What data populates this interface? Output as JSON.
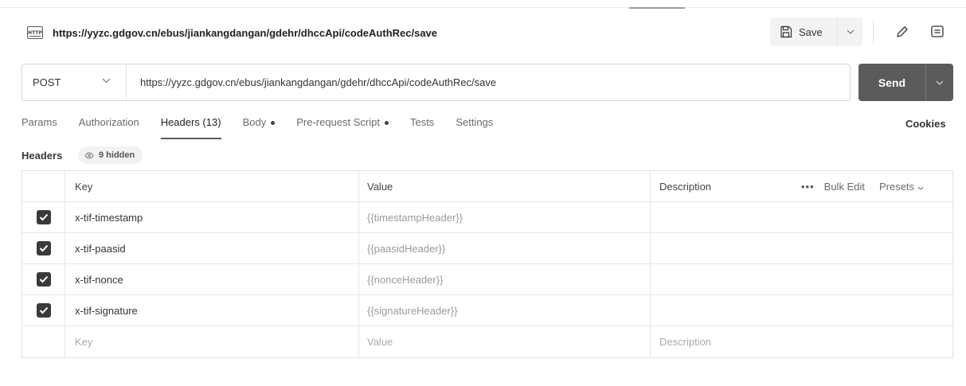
{
  "request": {
    "title": "https://yyzc.gdgov.cn/ebus/jiankangdangan/gdehr/dhccApi/codeAuthRec/save",
    "method": "POST",
    "url": "https://yyzc.gdgov.cn/ebus/jiankangdangan/gdehr/dhccApi/codeAuthRec/save"
  },
  "toolbar": {
    "save_label": "Save",
    "send_label": "Send"
  },
  "tabs": [
    {
      "label": "Params",
      "active": false,
      "dot": false
    },
    {
      "label": "Authorization",
      "active": false,
      "dot": false
    },
    {
      "label": "Headers (13)",
      "active": true,
      "dot": false
    },
    {
      "label": "Body",
      "active": false,
      "dot": true
    },
    {
      "label": "Pre-request Script",
      "active": false,
      "dot": true
    },
    {
      "label": "Tests",
      "active": false,
      "dot": false
    },
    {
      "label": "Settings",
      "active": false,
      "dot": false
    }
  ],
  "cookies_label": "Cookies",
  "headers_section": {
    "label": "Headers",
    "hidden_badge": "9 hidden"
  },
  "table": {
    "columns": {
      "key": "Key",
      "value": "Value",
      "description": "Description"
    },
    "actions": {
      "more": "•••",
      "bulk_edit": "Bulk Edit",
      "presets": "Presets"
    },
    "rows": [
      {
        "checked": true,
        "key": "x-tif-timestamp",
        "value": "{{timestampHeader}}",
        "description": ""
      },
      {
        "checked": true,
        "key": "x-tif-paasid",
        "value": "{{paasidHeader}}",
        "description": ""
      },
      {
        "checked": true,
        "key": "x-tif-nonce",
        "value": "{{nonceHeader}}",
        "description": ""
      },
      {
        "checked": true,
        "key": "x-tif-signature",
        "value": "{{signatureHeader}}",
        "description": ""
      }
    ],
    "empty_row": {
      "key": "Key",
      "value": "Value",
      "description": "Description"
    }
  },
  "colors": {
    "send_button": "#5b5b5b",
    "checkbox": "#3a3a3a",
    "active_tab_underline": "#5a5a5a"
  }
}
